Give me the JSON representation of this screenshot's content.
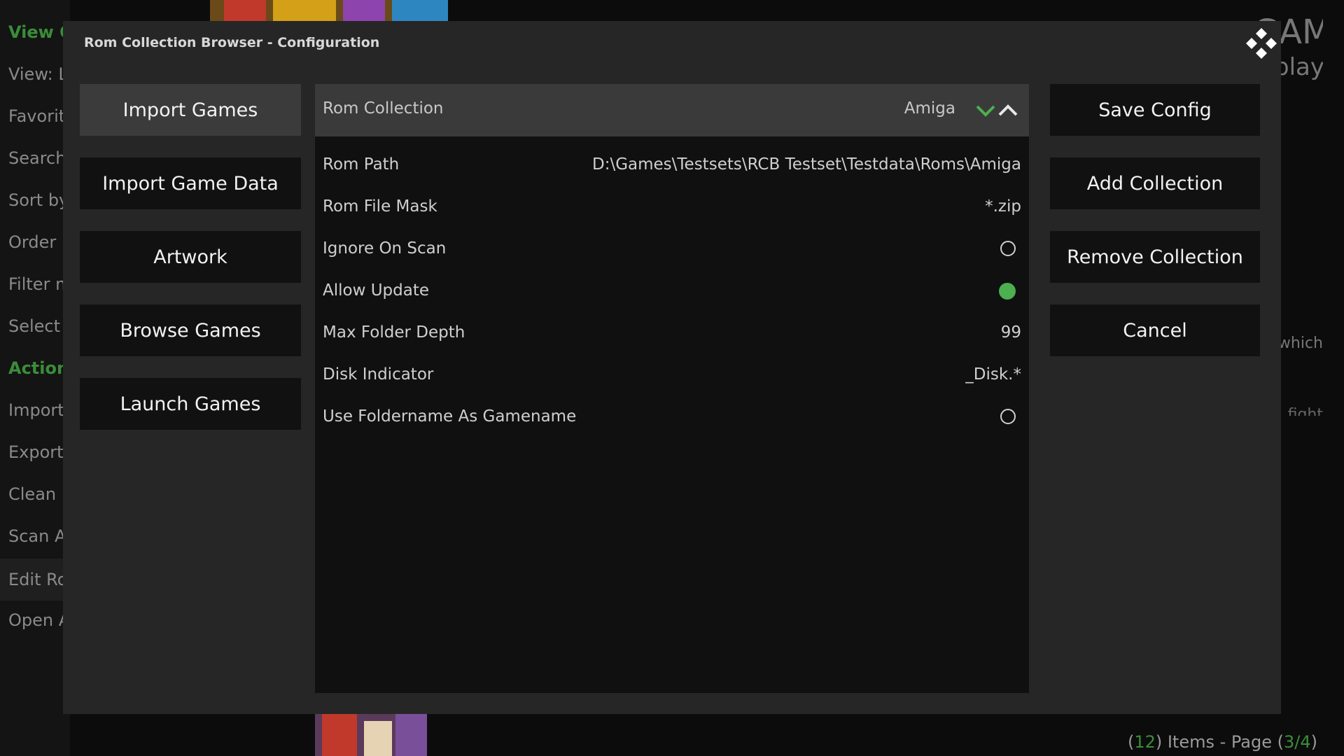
{
  "background": {
    "sidebar_items": [
      {
        "label": "View Options",
        "style": "green"
      },
      {
        "label": "View: List",
        "style": "normal"
      },
      {
        "label": "Favorites",
        "style": "normal"
      },
      {
        "label": "Search",
        "style": "normal"
      },
      {
        "label": "Sort by",
        "style": "normal"
      },
      {
        "label": "Order",
        "style": "normal"
      },
      {
        "label": "Filter menu",
        "style": "normal"
      },
      {
        "label": "Select Collection",
        "style": "normal"
      },
      {
        "label": "Actions",
        "style": "green"
      },
      {
        "label": "Import Games",
        "style": "normal"
      },
      {
        "label": "Export Game Data",
        "style": "normal"
      },
      {
        "label": "Clean Database",
        "style": "normal"
      },
      {
        "label": "Scan Artwork",
        "style": "normal"
      },
      {
        "label": "Edit Rom Collection",
        "style": "selected"
      },
      {
        "label": "Open Addon Settings",
        "style": "normal"
      }
    ],
    "title_fragment": "GAMES",
    "subtitle_fragment": "playing",
    "text_fragment_1": "which",
    "text_fragment_2": "fight",
    "footer": {
      "open_paren": "(",
      "items_count": "12",
      "mid_text": ") Items - Page (",
      "page": "3/4",
      "close_paren": ")"
    }
  },
  "dialog": {
    "title": "Rom Collection Browser - Configuration",
    "logo_icon": "kodi-logo-icon",
    "left_buttons": [
      "Import Games",
      "Import Game Data",
      "Artwork",
      "Browse Games",
      "Launch Games"
    ],
    "right_buttons": [
      "Save Config",
      "Add Collection",
      "Remove Collection",
      "Cancel"
    ],
    "rom_collection": {
      "label": "Rom Collection",
      "value": "Amiga"
    },
    "settings": {
      "rom_path": {
        "label": "Rom Path",
        "value": "D:\\Games\\Testsets\\RCB Testset\\Testdata\\Roms\\Amiga"
      },
      "rom_file_mask": {
        "label": "Rom File Mask",
        "value": "*.zip"
      },
      "ignore_on_scan": {
        "label": "Ignore On Scan",
        "checked": false
      },
      "allow_update": {
        "label": "Allow Update",
        "checked": true
      },
      "max_folder_depth": {
        "label": "Max Folder Depth",
        "value": "99"
      },
      "disk_indicator": {
        "label": "Disk Indicator",
        "value": "_Disk.*"
      },
      "use_foldername": {
        "label": "Use Foldername As Gamename",
        "checked": false
      }
    }
  },
  "colors": {
    "accent_green": "#4caf50",
    "focused_button": "#3b3b3b",
    "dialog_bg": "#262626"
  }
}
